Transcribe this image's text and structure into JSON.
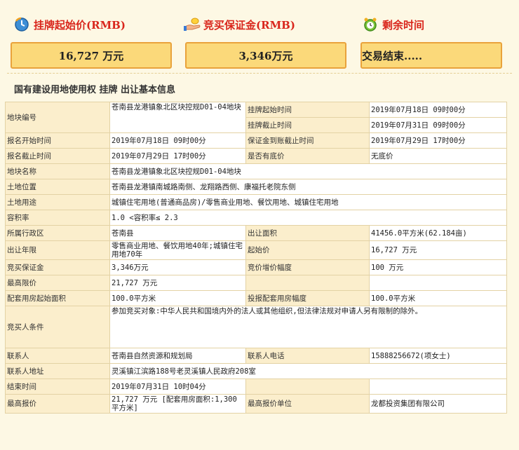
{
  "header": {
    "start_price_label": "挂牌起始价(RMB)",
    "start_price_value": "16,727 万元",
    "deposit_label": "竞买保证金(RMB)",
    "deposit_value": "3,346万元",
    "time_left_label": "剩余时间",
    "time_left_value": "交易结束....."
  },
  "section": {
    "title": "国有建设用地使用权 挂牌 出让基本信息"
  },
  "table": {
    "parcel_no_label": "地块编号",
    "parcel_no": "苍南县龙港镇象北区块控规D01-04地块",
    "listing_start_label": "挂牌起始时间",
    "listing_start": "2019年07月18日 09时00分",
    "listing_end_label": "挂牌截止时间",
    "listing_end": "2019年07月31日 09时00分",
    "reg_start_label": "报名开始时间",
    "reg_start": "2019年07月18日 09时00分",
    "deposit_deadline_label": "保证金到账截止时间",
    "deposit_deadline": "2019年07月29日 17时00分",
    "reg_end_label": "报名截止时间",
    "reg_end": "2019年07月29日 17时00分",
    "reserve_label": "是否有底价",
    "reserve": "无底价",
    "parcel_name_label": "地块名称",
    "parcel_name": "苍南县龙港镇象北区块控规D01-04地块",
    "location_label": "土地位置",
    "location": "苍南县龙港镇南城路南侧、龙翔路西侧、康福托老院东侧",
    "usage_label": "土地用途",
    "usage": "城镇住宅用地(普通商品房)/零售商业用地、餐饮用地、城镇住宅用地",
    "far_label": "容积率",
    "far": "1.0 <容积率≤ 2.3",
    "district_label": "所属行政区",
    "district": "苍南县",
    "area_label": "出让面积",
    "area": "41456.0平方米(62.184亩)",
    "term_label": "出让年限",
    "term": "零售商业用地、餐饮用地40年;城镇住宅用地70年",
    "start_price_label": "起始价",
    "start_price": "16,727 万元",
    "deposit_label": "竞买保证金",
    "deposit": "3,346万元",
    "increment_label": "竞价增价幅度",
    "increment": "100 万元",
    "max_price_label": "最高限价",
    "max_price": "21,727 万元",
    "housing_start_label": "配套用房起始面积",
    "housing_start": "100.0平方米",
    "housing_step_label": "投报配套用房幅度",
    "housing_step": "100.0平方米",
    "conditions_label": "竞买人条件",
    "conditions": "参加竞买对象:中华人民共和国境内外的法人或其他组织,但法律法规对申请人另有限制的除外。",
    "contact_label": "联系人",
    "contact": "苍南县自然资源和规划局",
    "phone_label": "联系人电话",
    "phone": "15888256672(项女士)",
    "address_label": "联系人地址",
    "address": "灵溪镇江滨路188号老灵溪镇人民政府208室",
    "end_time_label": "结束时间",
    "end_time": "2019年07月31日 10时04分",
    "top_bid_label": "最高报价",
    "top_bid": "21,727 万元 [配套用房面积:1,300平方米]",
    "top_bidder_label": "最高报价单位",
    "top_bidder": "龙都投资集团有限公司"
  }
}
